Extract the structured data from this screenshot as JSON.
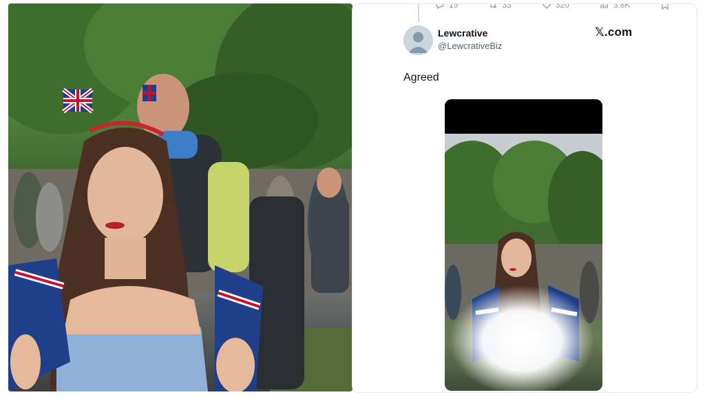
{
  "tweet": {
    "actions": [
      {
        "icon": "reply-icon",
        "count": "15"
      },
      {
        "icon": "retweet-icon",
        "count": "33"
      },
      {
        "icon": "like-icon",
        "count": "320"
      },
      {
        "icon": "views-icon",
        "count": "3.8K"
      }
    ],
    "author": {
      "display_name": "Lewcrative",
      "handle": "@LewcrativeBiz"
    },
    "brand": "𝕏.com",
    "text": "Agreed"
  },
  "colors": {
    "text_primary": "#0f1419",
    "text_secondary": "#536471",
    "card_border": "#e6e9ec",
    "avatar_bg": "#ccd6dd"
  }
}
